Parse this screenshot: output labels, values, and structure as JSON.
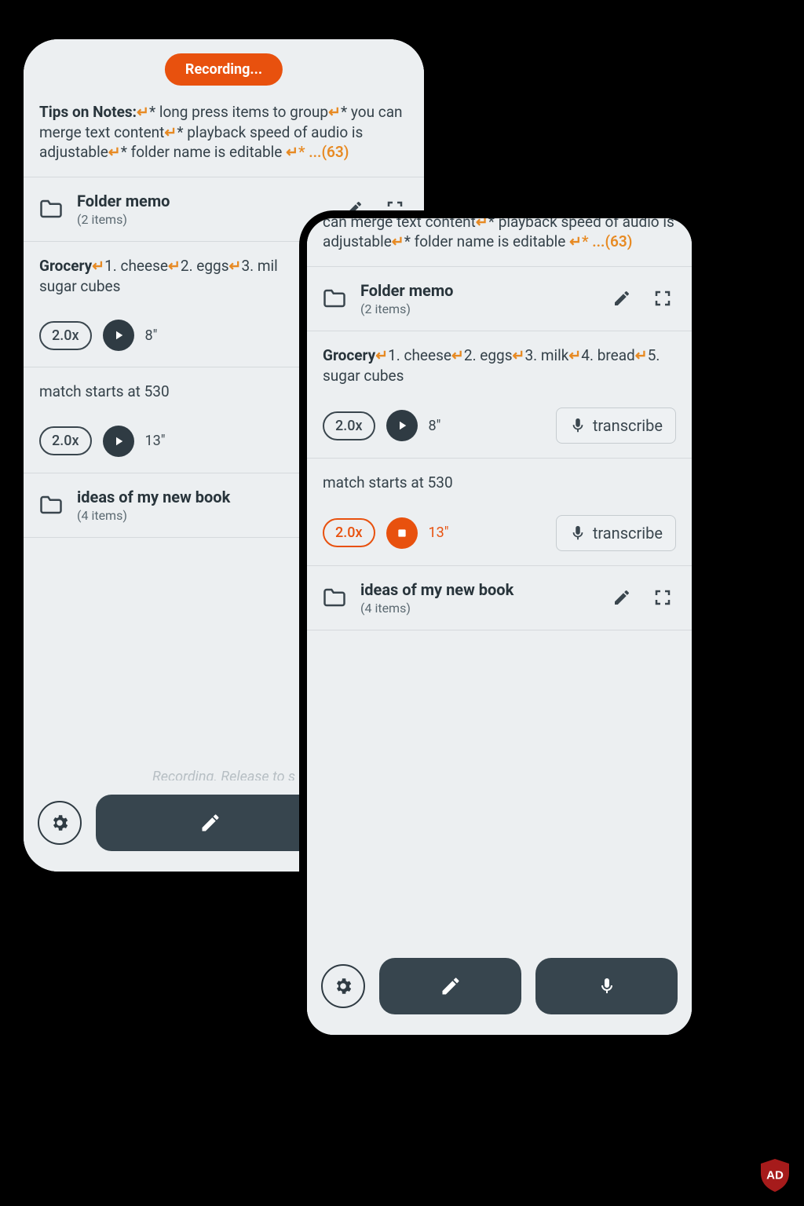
{
  "colors": {
    "accent": "#e8510e",
    "arrow": "#e78a23"
  },
  "recording_pill": "Recording...",
  "tips": {
    "title": "Tips on Notes:",
    "lines": [
      "* long press items to group",
      "* you can merge text content",
      "* playback speed of audio is adjustable",
      "* folder name is editable "
    ],
    "more": "* ...(63)"
  },
  "folders": {
    "memo": {
      "title": "Folder memo",
      "subtitle": "(2 items)"
    },
    "ideas": {
      "title": "ideas of my new book",
      "subtitle": "(4 items)"
    }
  },
  "grocery": {
    "title": "Grocery",
    "items": [
      "1. cheese",
      "2. eggs",
      "3. milk",
      "4. bread",
      "5. sugar cubes"
    ],
    "items_truncated_back": "3. mil"
  },
  "audio1": {
    "speed": "2.0x",
    "duration": "8\""
  },
  "match_text": "match starts at 530",
  "audio2": {
    "speed": "2.0x",
    "duration": "13\""
  },
  "transcribe_label": "transcribe",
  "hint": "Recording. Release to s",
  "ad_label": "AD"
}
